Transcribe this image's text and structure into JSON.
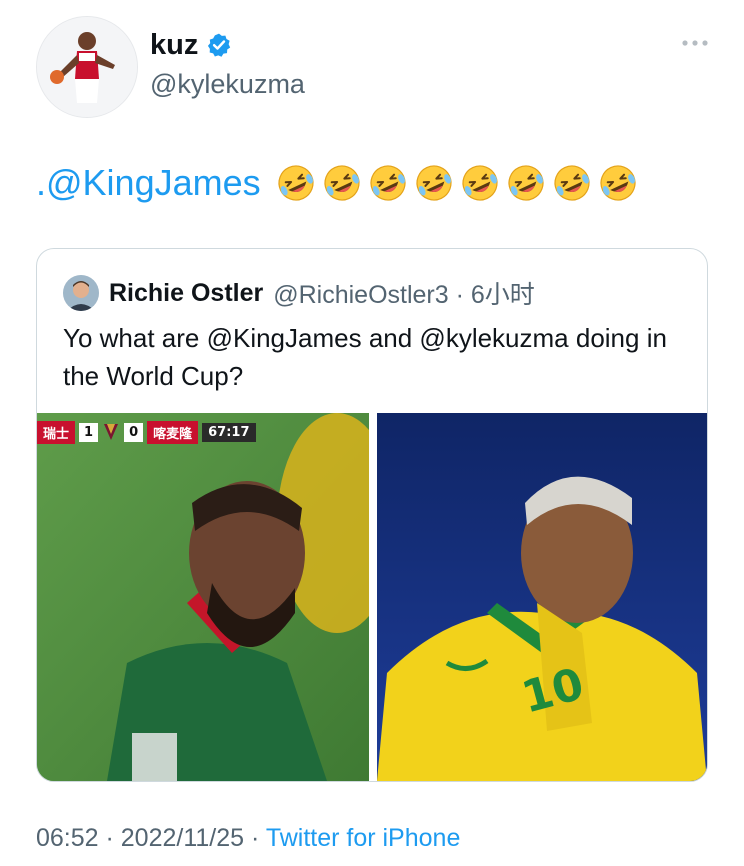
{
  "author": {
    "display_name": "kuz",
    "handle": "@kylekuzma",
    "verified_color": "#1d9bf0",
    "avatar_icon": "player-avatar-icon"
  },
  "tweet": {
    "mention": ".@KingJames",
    "emoji": "rolling-on-the-floor-laughing",
    "emoji_count": 8
  },
  "quote": {
    "display_name": "Richie Ostler",
    "handle_time": "@RichieOstler3 · 6小时",
    "text": "Yo what are @KingJames and @kylekuzma doing in the World Cup?",
    "media": [
      {
        "kind": "photo",
        "desc_icon": "cameroon-player-photo"
      },
      {
        "kind": "photo",
        "desc_icon": "brazil-player-photo"
      }
    ],
    "scorebug": {
      "team1": "瑞士",
      "score1": "1",
      "score2": "0",
      "team2": "喀麦隆",
      "clock": "67:17"
    }
  },
  "footer": {
    "time_date": "06:52 · 2022/11/25 · ",
    "source": "Twitter for iPhone"
  },
  "colors": {
    "accent": "#1d9bf0",
    "secondary_text": "#536471",
    "border": "#cfd9de"
  }
}
